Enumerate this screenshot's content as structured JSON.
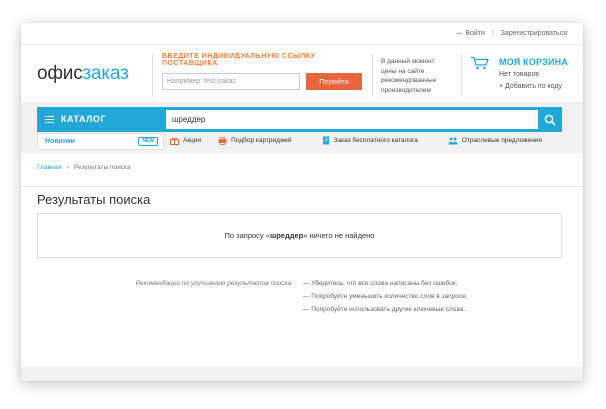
{
  "auth": {
    "login": "Войти",
    "register": "Зарегистрироваться"
  },
  "logo": {
    "part1": "офис",
    "part2": "заказ"
  },
  "supplier": {
    "title": "Введите индивидуальную ссылку поставщика",
    "placeholder": "Например: test-zakaz",
    "button": "Перейти"
  },
  "hint": {
    "line1": "В данный момент",
    "line2": "цены на сайте",
    "line3": "рекомендованные",
    "line4": "производителем"
  },
  "cart": {
    "title": "МОЯ КОРЗИНА",
    "empty": "Нет товаров",
    "add_by_code": "+ Добавить по коду"
  },
  "catalog": {
    "label": "КАТАЛОГ",
    "new_label": "Новинки",
    "new_badge": "NEW"
  },
  "search": {
    "query": "шреддер"
  },
  "links": [
    {
      "label": "Акции"
    },
    {
      "label": "Подбор картриджей"
    },
    {
      "label": "Заказ бесплатного каталога"
    },
    {
      "label": "Отраслевые предложения"
    }
  ],
  "breadcrumbs": {
    "home": "Главная",
    "current": "Результаты поиска"
  },
  "page": {
    "title": "Результаты поиска"
  },
  "result": {
    "prefix": "По запросу «",
    "query": "шреддер",
    "suffix": "» ничего не найдено"
  },
  "recommendations": {
    "label": "Рекомендации по улучшению результатов поиска:",
    "tips": [
      "—  Убедитесь, что все слова написаны без ошибок;",
      "—  Попробуйте уменьшить количество слов в запросе;",
      "—  Попробуйте использовать другие ключевые слова."
    ]
  },
  "colors": {
    "accent": "#21a8d8",
    "orange": "#e8663e",
    "band": "#f2f2f2"
  }
}
